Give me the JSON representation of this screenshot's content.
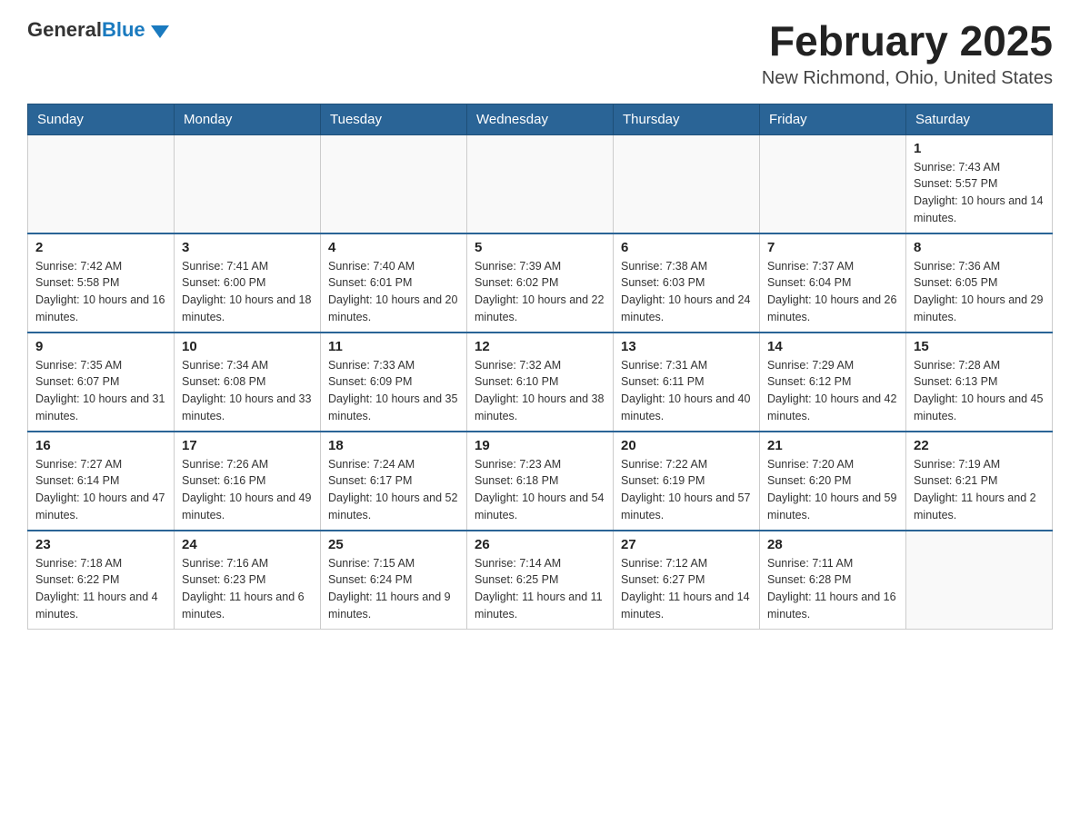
{
  "header": {
    "logo_general": "General",
    "logo_blue": "Blue",
    "month_title": "February 2025",
    "location": "New Richmond, Ohio, United States"
  },
  "days_of_week": [
    "Sunday",
    "Monday",
    "Tuesday",
    "Wednesday",
    "Thursday",
    "Friday",
    "Saturday"
  ],
  "weeks": [
    [
      {
        "day": "",
        "sunrise": "",
        "sunset": "",
        "daylight": ""
      },
      {
        "day": "",
        "sunrise": "",
        "sunset": "",
        "daylight": ""
      },
      {
        "day": "",
        "sunrise": "",
        "sunset": "",
        "daylight": ""
      },
      {
        "day": "",
        "sunrise": "",
        "sunset": "",
        "daylight": ""
      },
      {
        "day": "",
        "sunrise": "",
        "sunset": "",
        "daylight": ""
      },
      {
        "day": "",
        "sunrise": "",
        "sunset": "",
        "daylight": ""
      },
      {
        "day": "1",
        "sunrise": "Sunrise: 7:43 AM",
        "sunset": "Sunset: 5:57 PM",
        "daylight": "Daylight: 10 hours and 14 minutes."
      }
    ],
    [
      {
        "day": "2",
        "sunrise": "Sunrise: 7:42 AM",
        "sunset": "Sunset: 5:58 PM",
        "daylight": "Daylight: 10 hours and 16 minutes."
      },
      {
        "day": "3",
        "sunrise": "Sunrise: 7:41 AM",
        "sunset": "Sunset: 6:00 PM",
        "daylight": "Daylight: 10 hours and 18 minutes."
      },
      {
        "day": "4",
        "sunrise": "Sunrise: 7:40 AM",
        "sunset": "Sunset: 6:01 PM",
        "daylight": "Daylight: 10 hours and 20 minutes."
      },
      {
        "day": "5",
        "sunrise": "Sunrise: 7:39 AM",
        "sunset": "Sunset: 6:02 PM",
        "daylight": "Daylight: 10 hours and 22 minutes."
      },
      {
        "day": "6",
        "sunrise": "Sunrise: 7:38 AM",
        "sunset": "Sunset: 6:03 PM",
        "daylight": "Daylight: 10 hours and 24 minutes."
      },
      {
        "day": "7",
        "sunrise": "Sunrise: 7:37 AM",
        "sunset": "Sunset: 6:04 PM",
        "daylight": "Daylight: 10 hours and 26 minutes."
      },
      {
        "day": "8",
        "sunrise": "Sunrise: 7:36 AM",
        "sunset": "Sunset: 6:05 PM",
        "daylight": "Daylight: 10 hours and 29 minutes."
      }
    ],
    [
      {
        "day": "9",
        "sunrise": "Sunrise: 7:35 AM",
        "sunset": "Sunset: 6:07 PM",
        "daylight": "Daylight: 10 hours and 31 minutes."
      },
      {
        "day": "10",
        "sunrise": "Sunrise: 7:34 AM",
        "sunset": "Sunset: 6:08 PM",
        "daylight": "Daylight: 10 hours and 33 minutes."
      },
      {
        "day": "11",
        "sunrise": "Sunrise: 7:33 AM",
        "sunset": "Sunset: 6:09 PM",
        "daylight": "Daylight: 10 hours and 35 minutes."
      },
      {
        "day": "12",
        "sunrise": "Sunrise: 7:32 AM",
        "sunset": "Sunset: 6:10 PM",
        "daylight": "Daylight: 10 hours and 38 minutes."
      },
      {
        "day": "13",
        "sunrise": "Sunrise: 7:31 AM",
        "sunset": "Sunset: 6:11 PM",
        "daylight": "Daylight: 10 hours and 40 minutes."
      },
      {
        "day": "14",
        "sunrise": "Sunrise: 7:29 AM",
        "sunset": "Sunset: 6:12 PM",
        "daylight": "Daylight: 10 hours and 42 minutes."
      },
      {
        "day": "15",
        "sunrise": "Sunrise: 7:28 AM",
        "sunset": "Sunset: 6:13 PM",
        "daylight": "Daylight: 10 hours and 45 minutes."
      }
    ],
    [
      {
        "day": "16",
        "sunrise": "Sunrise: 7:27 AM",
        "sunset": "Sunset: 6:14 PM",
        "daylight": "Daylight: 10 hours and 47 minutes."
      },
      {
        "day": "17",
        "sunrise": "Sunrise: 7:26 AM",
        "sunset": "Sunset: 6:16 PM",
        "daylight": "Daylight: 10 hours and 49 minutes."
      },
      {
        "day": "18",
        "sunrise": "Sunrise: 7:24 AM",
        "sunset": "Sunset: 6:17 PM",
        "daylight": "Daylight: 10 hours and 52 minutes."
      },
      {
        "day": "19",
        "sunrise": "Sunrise: 7:23 AM",
        "sunset": "Sunset: 6:18 PM",
        "daylight": "Daylight: 10 hours and 54 minutes."
      },
      {
        "day": "20",
        "sunrise": "Sunrise: 7:22 AM",
        "sunset": "Sunset: 6:19 PM",
        "daylight": "Daylight: 10 hours and 57 minutes."
      },
      {
        "day": "21",
        "sunrise": "Sunrise: 7:20 AM",
        "sunset": "Sunset: 6:20 PM",
        "daylight": "Daylight: 10 hours and 59 minutes."
      },
      {
        "day": "22",
        "sunrise": "Sunrise: 7:19 AM",
        "sunset": "Sunset: 6:21 PM",
        "daylight": "Daylight: 11 hours and 2 minutes."
      }
    ],
    [
      {
        "day": "23",
        "sunrise": "Sunrise: 7:18 AM",
        "sunset": "Sunset: 6:22 PM",
        "daylight": "Daylight: 11 hours and 4 minutes."
      },
      {
        "day": "24",
        "sunrise": "Sunrise: 7:16 AM",
        "sunset": "Sunset: 6:23 PM",
        "daylight": "Daylight: 11 hours and 6 minutes."
      },
      {
        "day": "25",
        "sunrise": "Sunrise: 7:15 AM",
        "sunset": "Sunset: 6:24 PM",
        "daylight": "Daylight: 11 hours and 9 minutes."
      },
      {
        "day": "26",
        "sunrise": "Sunrise: 7:14 AM",
        "sunset": "Sunset: 6:25 PM",
        "daylight": "Daylight: 11 hours and 11 minutes."
      },
      {
        "day": "27",
        "sunrise": "Sunrise: 7:12 AM",
        "sunset": "Sunset: 6:27 PM",
        "daylight": "Daylight: 11 hours and 14 minutes."
      },
      {
        "day": "28",
        "sunrise": "Sunrise: 7:11 AM",
        "sunset": "Sunset: 6:28 PM",
        "daylight": "Daylight: 11 hours and 16 minutes."
      },
      {
        "day": "",
        "sunrise": "",
        "sunset": "",
        "daylight": ""
      }
    ]
  ]
}
